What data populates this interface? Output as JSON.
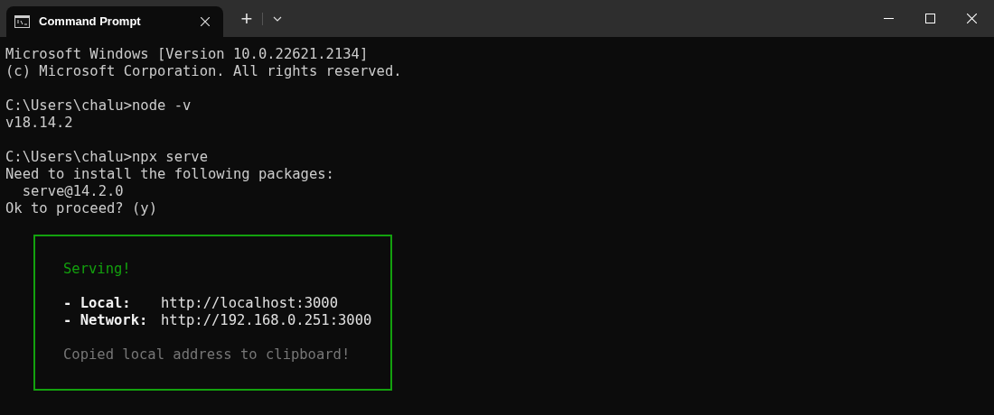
{
  "tabs": [
    {
      "label": "Command Prompt",
      "selected": true
    }
  ],
  "tab_bar": {
    "new_tab": "+"
  },
  "lines": [
    {
      "kind": "text",
      "text": "Microsoft Windows [Version 10.0.22621.2134]"
    },
    {
      "kind": "text",
      "text": "(c) Microsoft Corporation. All rights reserved."
    },
    {
      "kind": "blank"
    },
    {
      "kind": "text",
      "text": "C:\\Users\\chalu>node -v"
    },
    {
      "kind": "text",
      "text": "v18.14.2"
    },
    {
      "kind": "blank"
    },
    {
      "kind": "text",
      "text": "C:\\Users\\chalu>npx serve"
    },
    {
      "kind": "text",
      "text": "Need to install the following packages:"
    },
    {
      "kind": "text",
      "text": "  serve@14.2.0"
    },
    {
      "kind": "text",
      "text": "Ok to proceed? (y)"
    }
  ],
  "serve_box": {
    "lines": [
      {
        "kind": "heading",
        "text": "Serving!"
      },
      {
        "kind": "blank"
      },
      {
        "kind": "address",
        "label": "- Local:",
        "value": "http://localhost:3000"
      },
      {
        "kind": "address",
        "label": "- Network:",
        "value": "http://192.168.0.251:3000"
      },
      {
        "kind": "blank"
      },
      {
        "kind": "note",
        "text": "Copied local address to clipboard!"
      }
    ]
  }
}
